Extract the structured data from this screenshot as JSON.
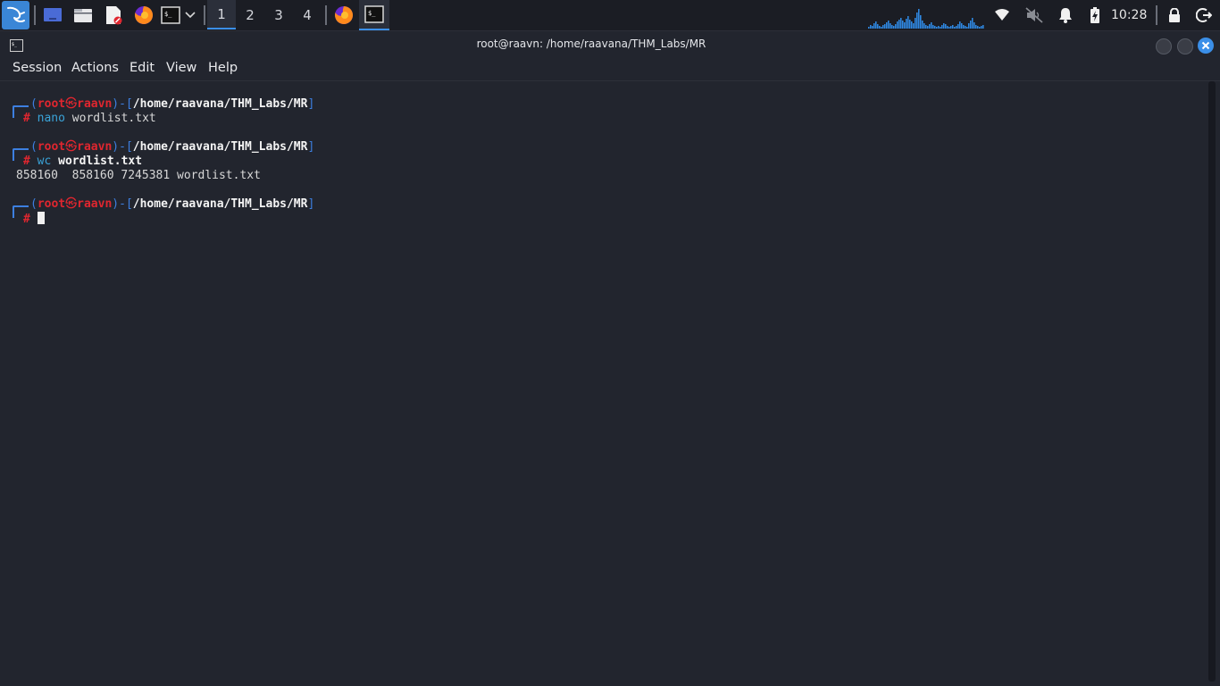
{
  "taskbar": {
    "workspaces": [
      "1",
      "2",
      "3",
      "4"
    ],
    "active_workspace": "1",
    "clock": "10:28",
    "icons": [
      "kali-menu-icon",
      "desktop-icon",
      "file-manager-icon",
      "text-editor-icon",
      "firefox-icon",
      "terminal-icon",
      "chevron-down-icon",
      "wifi-icon",
      "speaker-muted-icon",
      "bell-icon",
      "battery-icon",
      "lock-icon",
      "logout-icon"
    ]
  },
  "window": {
    "title": "root@raavn: /home/raavana/THM_Labs/MR"
  },
  "menu": {
    "session": "Session",
    "actions": "Actions",
    "edit": "Edit",
    "view": "View",
    "help": "Help"
  },
  "terminal": {
    "prompt": {
      "open": "(",
      "user": "root",
      "at": "㉿",
      "host": "raavn",
      "mid": ")-[",
      "path": "/home/raavana/THM_Labs/MR",
      "close": "]",
      "hash": "#"
    },
    "blocks": [
      {
        "cmd_name": "nano",
        "cmd_args": "wordlist.txt",
        "output": ""
      },
      {
        "cmd_name": "wc",
        "cmd_args": "wordlist.txt",
        "output": "858160  858160 7245381 wordlist.txt"
      },
      {
        "cmd_name": "",
        "cmd_args": "",
        "output": ""
      }
    ]
  },
  "colors": {
    "accent": "#3b8fe8",
    "prompt_blue": "#3d7fe0",
    "prompt_red": "#e0262f",
    "background": "#22252e"
  }
}
